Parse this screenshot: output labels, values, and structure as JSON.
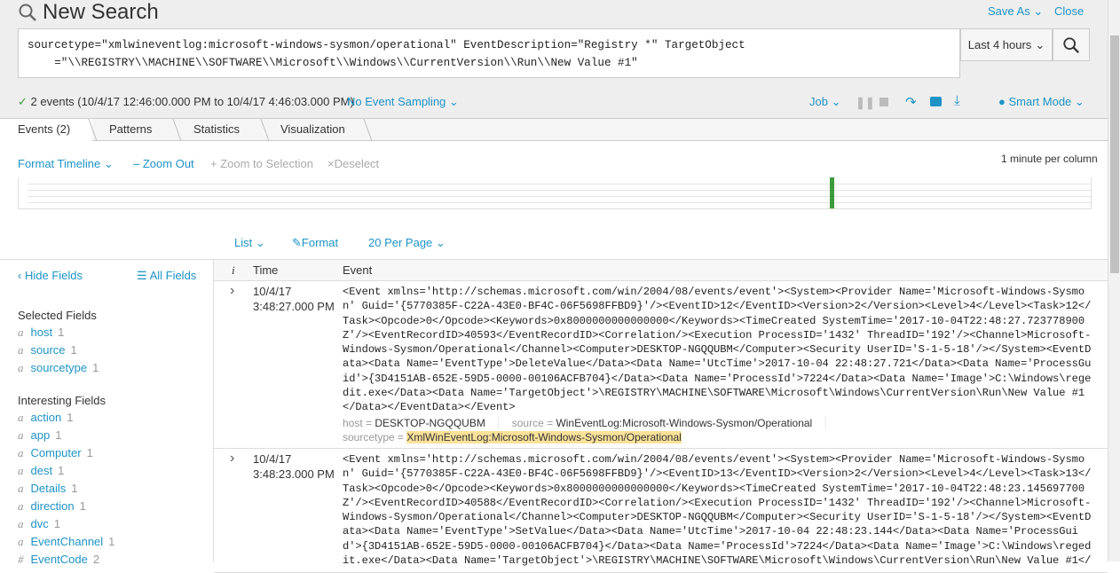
{
  "header": {
    "title": "New Search",
    "save_as": "Save As",
    "close": "Close"
  },
  "search": {
    "query_lines": [
      "sourcetype=\"xmlwineventlog:microsoft-windows-sysmon/operational\" EventDescription=\"Registry *\" TargetObject",
      "    =\"\\\\REGISTRY\\\\MACHINE\\\\SOFTWARE\\\\Microsoft\\\\Windows\\\\CurrentVersion\\\\Run\\\\New Value #1\""
    ],
    "time_range": "Last 4 hours"
  },
  "status": {
    "events_text": "2 events (10/4/17 12:46:00.000 PM to 10/4/17 4:46:03.000 PM)",
    "sampling": "No Event Sampling",
    "job": "Job",
    "mode": "Smart Mode"
  },
  "tabs": [
    "Events (2)",
    "Patterns",
    "Statistics",
    "Visualization"
  ],
  "timeline": {
    "format": "Format Timeline",
    "zoom_out": "Zoom Out",
    "zoom_sel": "Zoom to Selection",
    "deselect": "Deselect",
    "scale": "1 minute per column",
    "accent": "#3c9c3c"
  },
  "results_bar": {
    "list": "List",
    "format": "Format",
    "per_page": "20 Per Page"
  },
  "sidebar": {
    "hide_fields": "Hide Fields",
    "all_fields": "All Fields",
    "selected_title": "Selected Fields",
    "selected": [
      {
        "type": "a",
        "name": "host",
        "count": "1"
      },
      {
        "type": "a",
        "name": "source",
        "count": "1"
      },
      {
        "type": "a",
        "name": "sourcetype",
        "count": "1"
      }
    ],
    "interesting_title": "Interesting Fields",
    "interesting": [
      {
        "type": "a",
        "name": "action",
        "count": "1"
      },
      {
        "type": "a",
        "name": "app",
        "count": "1"
      },
      {
        "type": "a",
        "name": "Computer",
        "count": "1"
      },
      {
        "type": "a",
        "name": "dest",
        "count": "1"
      },
      {
        "type": "a",
        "name": "Details",
        "count": "1"
      },
      {
        "type": "a",
        "name": "direction",
        "count": "1"
      },
      {
        "type": "a",
        "name": "dvc",
        "count": "1"
      },
      {
        "type": "a",
        "name": "EventChannel",
        "count": "1"
      },
      {
        "type": "#",
        "name": "EventCode",
        "count": "2"
      }
    ]
  },
  "table": {
    "col_i": "i",
    "col_time": "Time",
    "col_event": "Event",
    "rows": [
      {
        "date": "10/4/17",
        "time": "3:48:27.000 PM",
        "lines": [
          "<Event xmlns='http://schemas.microsoft.com/win/2004/08/events/event'><System><Provider Name='Microsoft-Windows-Sysmo",
          "n' Guid='{5770385F-C22A-43E0-BF4C-06F5698FFBD9}'/><EventID>12</EventID><Version>2</Version><Level>4</Level><Task>12</",
          "Task><Opcode>0</Opcode><Keywords>0x8000000000000000</Keywords><TimeCreated SystemTime='2017-10-04T22:48:27.723778900",
          "Z'/><EventRecordID>40593</EventRecordID><Correlation/><Execution ProcessID='1432' ThreadID='192'/><Channel>Microsoft-",
          "Windows-Sysmon/Operational</Channel><Computer>DESKTOP-NGQQUBM</Computer><Security UserID='S-1-5-18'/></System><EventD",
          "ata><Data Name='EventType'>DeleteValue</Data><Data Name='UtcTime'>2017-10-04 22:48:27.721</Data><Data Name='ProcessGu",
          "id'>{3D4151AB-652E-59D5-0000-00106ACFB704}</Data><Data Name='ProcessId'>7224</Data><Data Name='Image'>C:\\Windows\\rege",
          "dit.exe</Data><Data Name='TargetObject'>\\REGISTRY\\MACHINE\\SOFTWARE\\Microsoft\\Windows\\CurrentVersion\\Run\\New Value #1",
          "</Data></EventData></Event>"
        ],
        "host": "DESKTOP-NGQQUBM",
        "source": "WinEventLog:Microsoft-Windows-Sysmon/Operational",
        "sourcetype": "XmlWinEventLog:Microsoft-Windows-Sysmon/Operational"
      },
      {
        "date": "10/4/17",
        "time": "3:48:23.000 PM",
        "lines": [
          "<Event xmlns='http://schemas.microsoft.com/win/2004/08/events/event'><System><Provider Name='Microsoft-Windows-Sysmo",
          "n' Guid='{5770385F-C22A-43E0-BF4C-06F5698FFBD9}'/><EventID>13</EventID><Version>2</Version><Level>4</Level><Task>13</",
          "Task><Opcode>0</Opcode><Keywords>0x8000000000000000</Keywords><TimeCreated SystemTime='2017-10-04T22:48:23.145697700",
          "Z'/><EventRecordID>40588</EventRecordID><Correlation/><Execution ProcessID='1432' ThreadID='192'/><Channel>Microsoft-",
          "Windows-Sysmon/Operational</Channel><Computer>DESKTOP-NGQQUBM</Computer><Security UserID='S-1-5-18'/></System><EventD",
          "ata><Data Name='EventType'>SetValue</Data><Data Name='UtcTime'>2017-10-04 22:48:23.144</Data><Data Name='ProcessGui",
          "d'>{3D4151AB-652E-59D5-0000-00106ACFB704}</Data><Data Name='ProcessId'>7224</Data><Data Name='Image'>C:\\Windows\\reged",
          "it.exe</Data><Data Name='TargetObject'>\\REGISTRY\\MACHINE\\SOFTWARE\\Microsoft\\Windows\\CurrentVersion\\Run\\New Value #1</"
        ]
      }
    ]
  }
}
